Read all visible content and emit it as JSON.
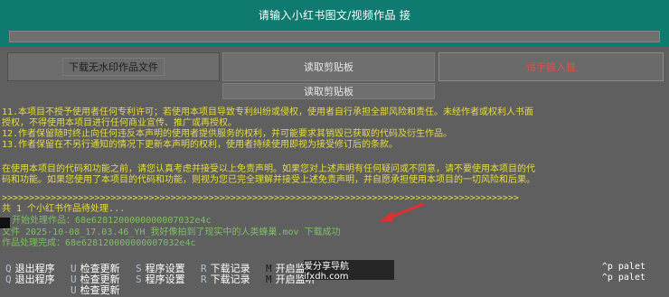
{
  "header": {
    "prompt": "请输入小红书图文/视频作品 接 ",
    "url_value": ""
  },
  "buttons": {
    "download": "下载无水印作品文件",
    "read_clipboard_1": "读取剪贴板",
    "read_clipboard_2": "读取剪贴板",
    "manual_input": "请手输入框"
  },
  "console": {
    "disclaimer": [
      "11.本项目不授予使用者任何专利许可；若使用本项目导致专利纠纷或侵权，使用者自行承担全部风险和责任。未经作者或权利人书面",
      "授权，不得使用本项目进行任何商业宣传、推广或再授权。",
      "12.作者保留随时终止向任何违反本声明的使用者提供服务的权利，并可能要求其销毁已获取的代码及衍生作品。",
      "13.作者保留在不另行通知的情况下更新本声明的权利，使用者持续使用即视为接受修订后的条款。",
      "",
      "在使用本项目的代码和功能之前，请您认真考虑并接受以上免责声明。如果您对上述声明有任何疑问或不同意，请不要使用本项目的代",
      "码和功能。如果您使用了本项目的代码和功能，则视为您已完全理解并接受上述免责声明，并自愿承担使用本项目的一切风险和后果。"
    ],
    "separator": ">>>>>>>>>>>>>>>>>>>>>>>>>>>>>>>>>>>>>>>>>>>>>>>>>>>>>>>>>>>>>>>>>>>>>>>>>>>>>>>>>>>>>>>>>>>>>>>",
    "log": [
      "共 1 个小红书作品待处理...",
      "开始处理作品：68e6281200000000007032e4c",
      "文件 2025-10-08_17.03.46_YH_我好像拍到了现实中的人类蜂巢.mov 下载成功",
      "作品处理完成：68e628120000000007032e4c"
    ]
  },
  "shortcuts": [
    {
      "key": "Q",
      "label": "退出程序"
    },
    {
      "key": "U",
      "label": "检查更新"
    },
    {
      "key": "S",
      "label": "程序设置"
    },
    {
      "key": "R",
      "label": "下载记录"
    },
    {
      "key": "M",
      "label": "开启监听"
    },
    {
      "key": "Q",
      "label": "退出程序"
    },
    {
      "key": "U",
      "label": "检查更新"
    },
    {
      "key": "S",
      "label": "程序设置"
    },
    {
      "key": "R",
      "label": "下载记录"
    },
    {
      "key": "M",
      "label": "开启监听"
    },
    {
      "key": "U",
      "label": "检查更新"
    }
  ],
  "palette": [
    "^p palet",
    "^p palet"
  ],
  "watermark": "爱分享导航 ifxdh.com",
  "colors": {
    "header": "#0f7a6f",
    "background": "#5f5f5f",
    "text_yellow": "#e5dc43",
    "text_green": "#7ebf60",
    "accent_red": "#d9534f",
    "arrow_red": "#e03030"
  },
  "icons": [
    "red-arrow-icon",
    "terminal-cursor-icon"
  ]
}
